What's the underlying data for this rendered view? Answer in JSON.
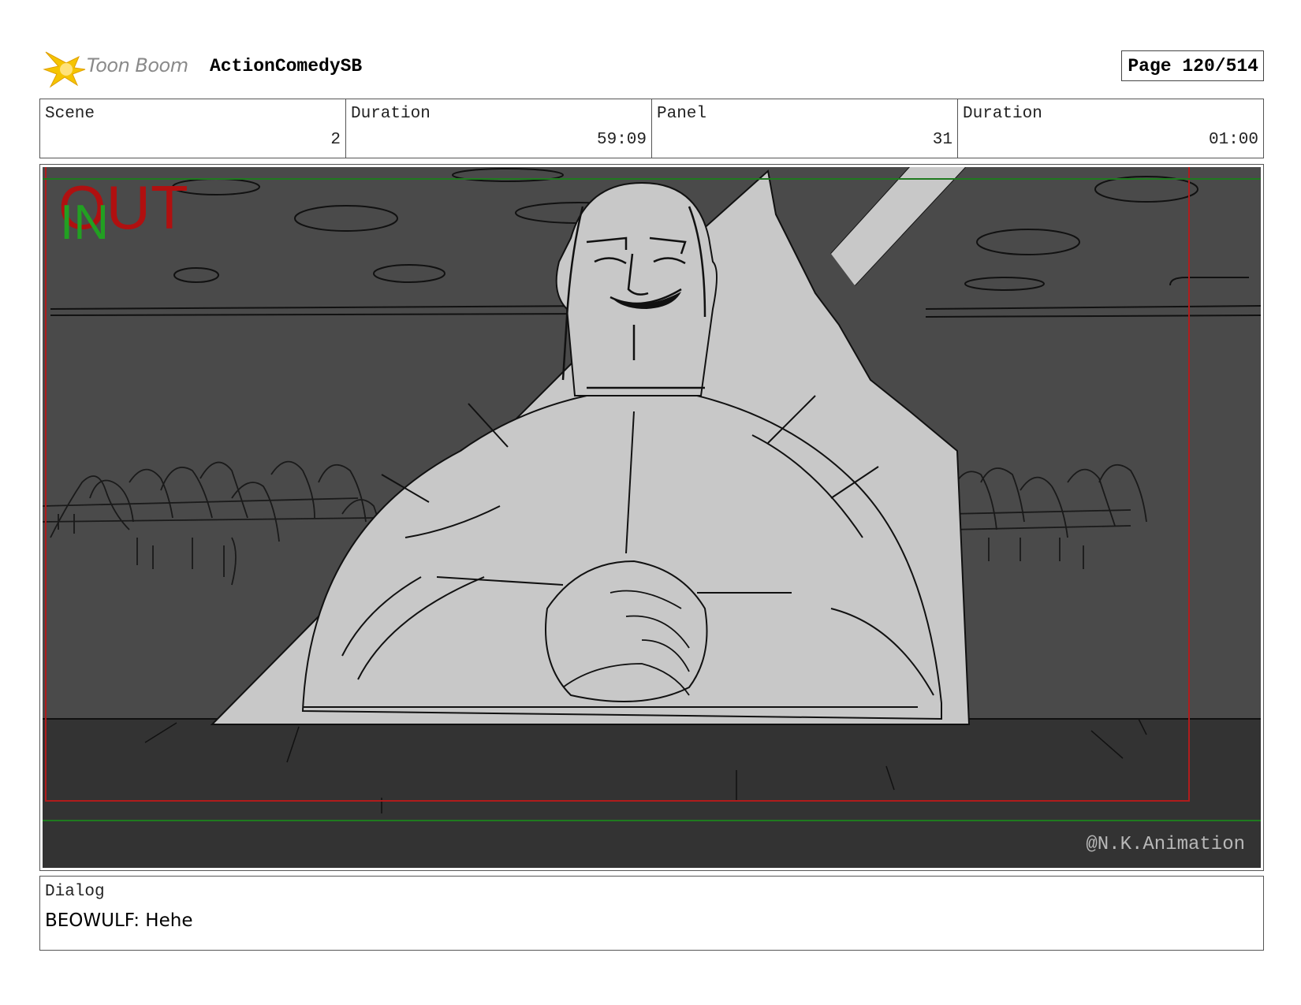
{
  "header": {
    "logo_text": "Toon Boom",
    "project_title": "ActionComedySB",
    "page_label": "Page 120/514"
  },
  "info": [
    {
      "label": "Scene",
      "value": "2"
    },
    {
      "label": "Duration",
      "value": "59:09"
    },
    {
      "label": "Panel",
      "value": "31"
    },
    {
      "label": "Duration",
      "value": "01:00"
    }
  ],
  "panel": {
    "out_marker": "OUT",
    "in_marker": "IN",
    "watermark": "@N.K.Animation",
    "colors": {
      "sky": "#4a4a4a",
      "table": "#333333",
      "figure": "#c8c8c8",
      "safe_frame": "#b01c1c",
      "guide_line": "#1f7a1f",
      "out_marker": "#b01010",
      "in_marker": "#22a022"
    }
  },
  "dialog": {
    "label": "Dialog",
    "text": "BEOWULF: Hehe"
  }
}
